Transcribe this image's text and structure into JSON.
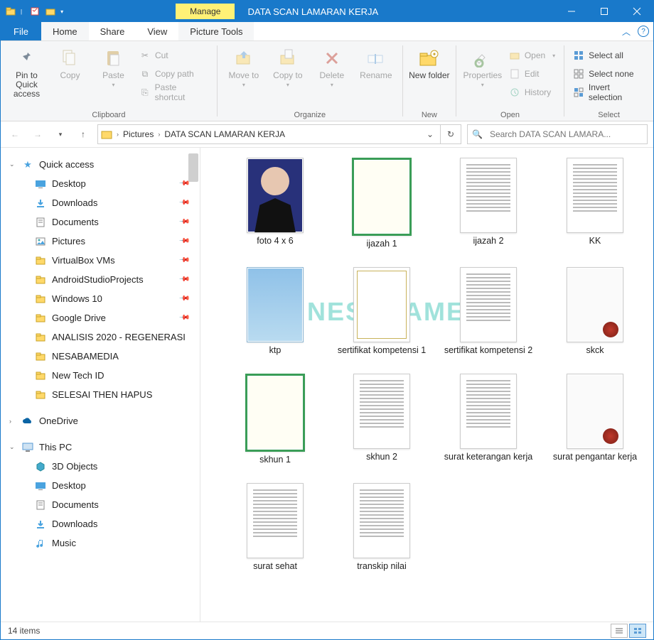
{
  "title": "DATA SCAN LAMARAN KERJA",
  "context_tab": "Manage",
  "tabs": {
    "file": "File",
    "home": "Home",
    "share": "Share",
    "view": "View",
    "picture": "Picture Tools"
  },
  "ribbon": {
    "pin": "Pin to Quick access",
    "copy": "Copy",
    "paste": "Paste",
    "cut": "Cut",
    "copypath": "Copy path",
    "pasteshortcut": "Paste shortcut",
    "clipboard": "Clipboard",
    "moveto": "Move to",
    "copyto": "Copy to",
    "delete": "Delete",
    "rename": "Rename",
    "organize": "Organize",
    "newfolder": "New folder",
    "newgroup": "New",
    "properties": "Properties",
    "open": "Open",
    "edit": "Edit",
    "history": "History",
    "opengroup": "Open",
    "selectall": "Select all",
    "selectnone": "Select none",
    "invert": "Invert selection",
    "selectgroup": "Select"
  },
  "breadcrumb": {
    "p1": "Pictures",
    "p2": "DATA SCAN LAMARAN KERJA"
  },
  "search_placeholder": "Search DATA SCAN LAMARA...",
  "nav": {
    "quick": "Quick access",
    "items": [
      "Desktop",
      "Downloads",
      "Documents",
      "Pictures",
      "VirtualBox VMs",
      "AndroidStudioProjects",
      "Windows 10",
      "Google Drive",
      "ANALISIS 2020 - REGENERASI",
      "NESABAMEDIA",
      "New Tech ID",
      "SELESAI THEN HAPUS"
    ],
    "onedrive": "OneDrive",
    "thispc": "This PC",
    "pc": [
      "3D Objects",
      "Desktop",
      "Documents",
      "Downloads",
      "Music"
    ]
  },
  "files": [
    {
      "name": "foto 4 x 6",
      "kind": "photo"
    },
    {
      "name": "ijazah 1",
      "kind": "cert"
    },
    {
      "name": "ijazah 2",
      "kind": "doc"
    },
    {
      "name": "KK",
      "kind": "doc"
    },
    {
      "name": "ktp",
      "kind": "idcard"
    },
    {
      "name": "sertifikat kompetensi 1",
      "kind": "cert2"
    },
    {
      "name": "sertifikat kompetensi 2",
      "kind": "doc"
    },
    {
      "name": "skck",
      "kind": "stamp"
    },
    {
      "name": "skhun 1",
      "kind": "cert"
    },
    {
      "name": "skhun 2",
      "kind": "doc"
    },
    {
      "name": "surat keterangan kerja",
      "kind": "doc"
    },
    {
      "name": "surat pengantar kerja",
      "kind": "stamp"
    },
    {
      "name": "surat sehat",
      "kind": "doc"
    },
    {
      "name": "transkip nilai",
      "kind": "doc"
    }
  ],
  "status": "14 items",
  "watermark": "NESABAMEDIA"
}
